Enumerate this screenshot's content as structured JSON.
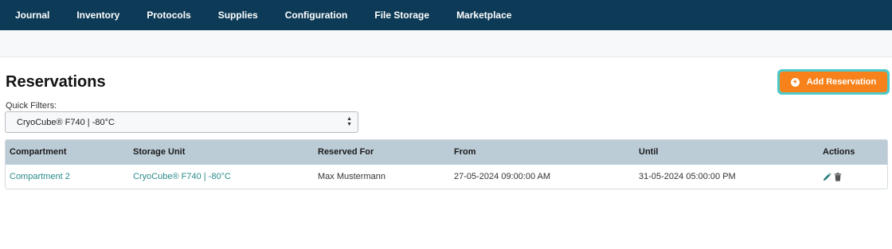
{
  "nav": {
    "items": [
      {
        "label": "Journal"
      },
      {
        "label": "Inventory"
      },
      {
        "label": "Protocols"
      },
      {
        "label": "Supplies"
      },
      {
        "label": "Configuration"
      },
      {
        "label": "File Storage"
      },
      {
        "label": "Marketplace"
      }
    ]
  },
  "page": {
    "title": "Reservations",
    "add_button_label": "Add Reservation",
    "add_button_icon": "plus-circle-icon"
  },
  "filters": {
    "label": "Quick Filters:",
    "selected": "CryoCube® F740 | -80°C"
  },
  "table": {
    "headers": {
      "compartment": "Compartment",
      "storage_unit": "Storage Unit",
      "reserved_for": "Reserved For",
      "from": "From",
      "until": "Until",
      "actions": "Actions"
    },
    "rows": [
      {
        "compartment": "Compartment 2",
        "storage_unit": "CryoCube® F740 | -80°C",
        "reserved_for": "Max Mustermann",
        "from": "27-05-2024 09:00:00 AM",
        "until": "31-05-2024 05:00:00 PM"
      }
    ]
  },
  "colors": {
    "nav_bg": "#0d3b57",
    "accent_orange": "#f7821b",
    "focus_ring": "#4fc9c8",
    "table_header_bg": "#bcccd6",
    "link": "#2a8a8a"
  }
}
